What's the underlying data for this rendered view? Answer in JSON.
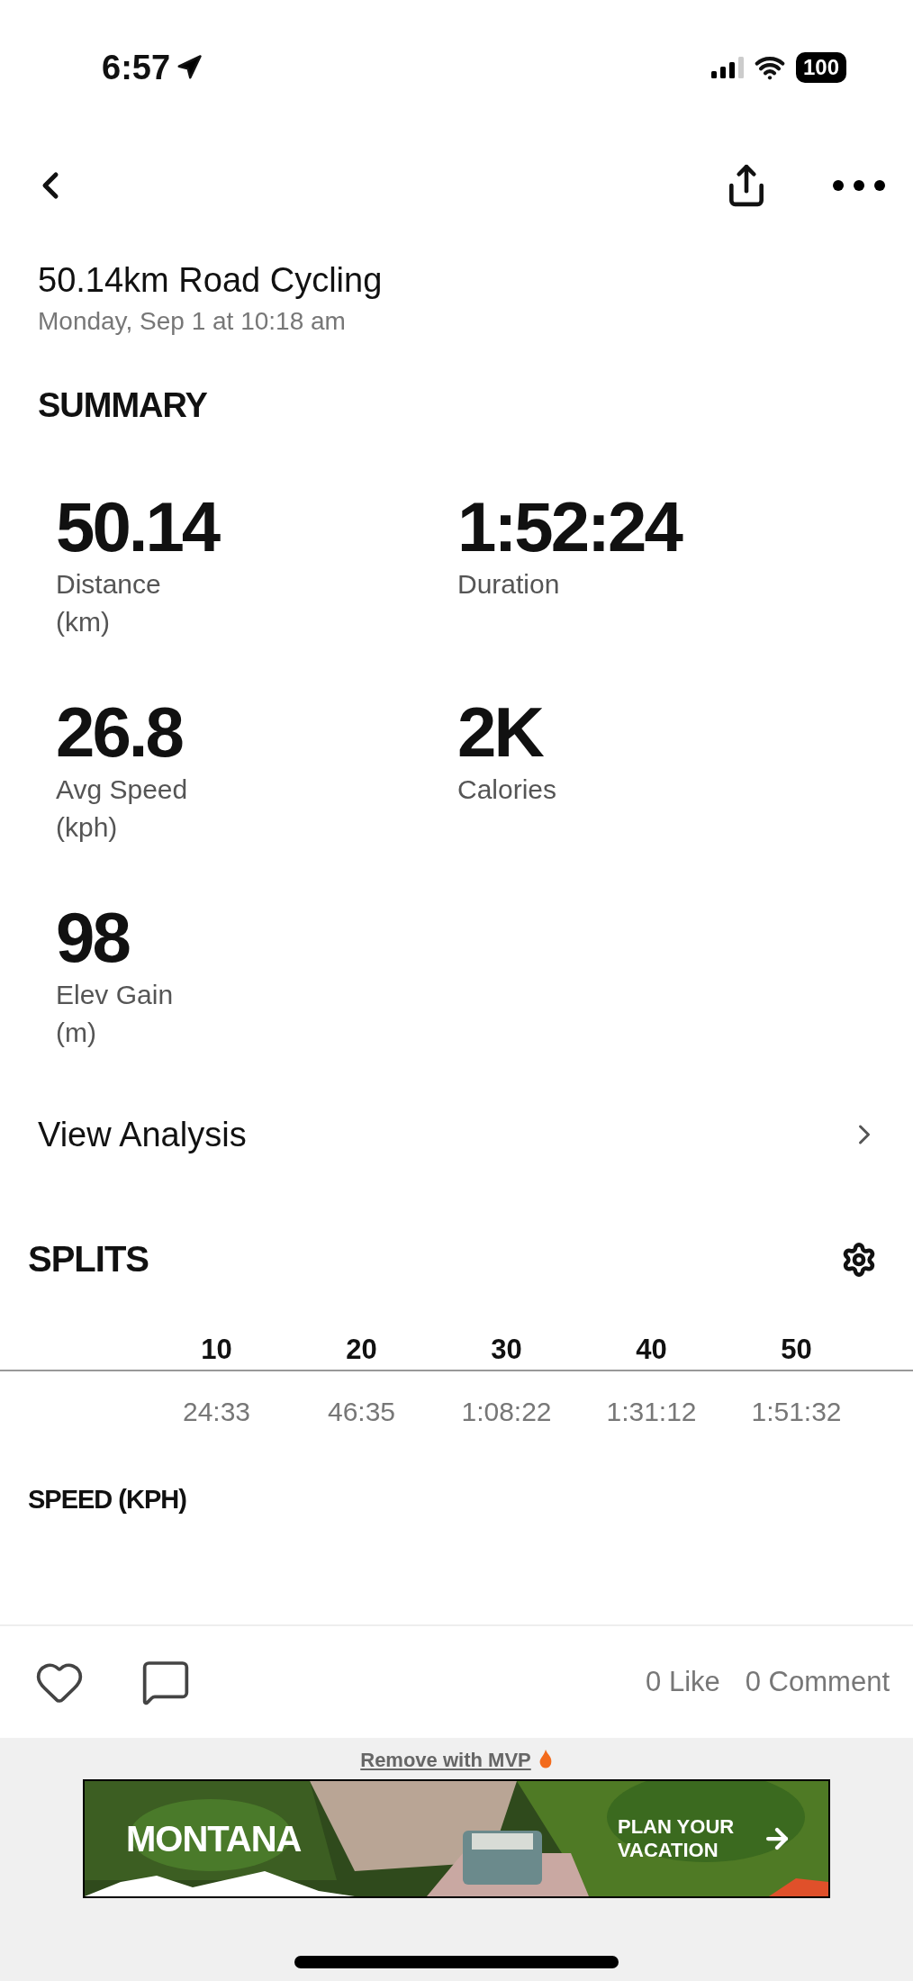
{
  "status_bar": {
    "time": "6:57",
    "battery": "100"
  },
  "activity": {
    "title": "50.14km Road Cycling",
    "date": "Monday, Sep 1 at 10:18 am"
  },
  "summary": {
    "heading": "SUMMARY",
    "stats": [
      {
        "value": "50.14",
        "label": "Distance",
        "unit": "(km)"
      },
      {
        "value": "1:52:24",
        "label": "Duration"
      },
      {
        "value": "26.8",
        "label": "Avg Speed",
        "unit": "(kph)"
      },
      {
        "value": "2K",
        "label": "Calories"
      },
      {
        "value": "98",
        "label": "Elev Gain",
        "unit": "(m)"
      }
    ]
  },
  "view_analysis": "View Analysis",
  "splits": {
    "heading": "SPLITS",
    "columns": [
      {
        "header": "10",
        "time": "24:33"
      },
      {
        "header": "20",
        "time": "46:35"
      },
      {
        "header": "30",
        "time": "1:08:22"
      },
      {
        "header": "40",
        "time": "1:31:12"
      },
      {
        "header": "50",
        "time": "1:51:32"
      }
    ],
    "speed_heading": "SPEED (KPH)"
  },
  "footer": {
    "likes": "0 Like",
    "comments": "0 Comment"
  },
  "ad": {
    "remove_link": "Remove with MVP",
    "headline": "MONTANA",
    "cta": "PLAN YOUR VACATION"
  }
}
